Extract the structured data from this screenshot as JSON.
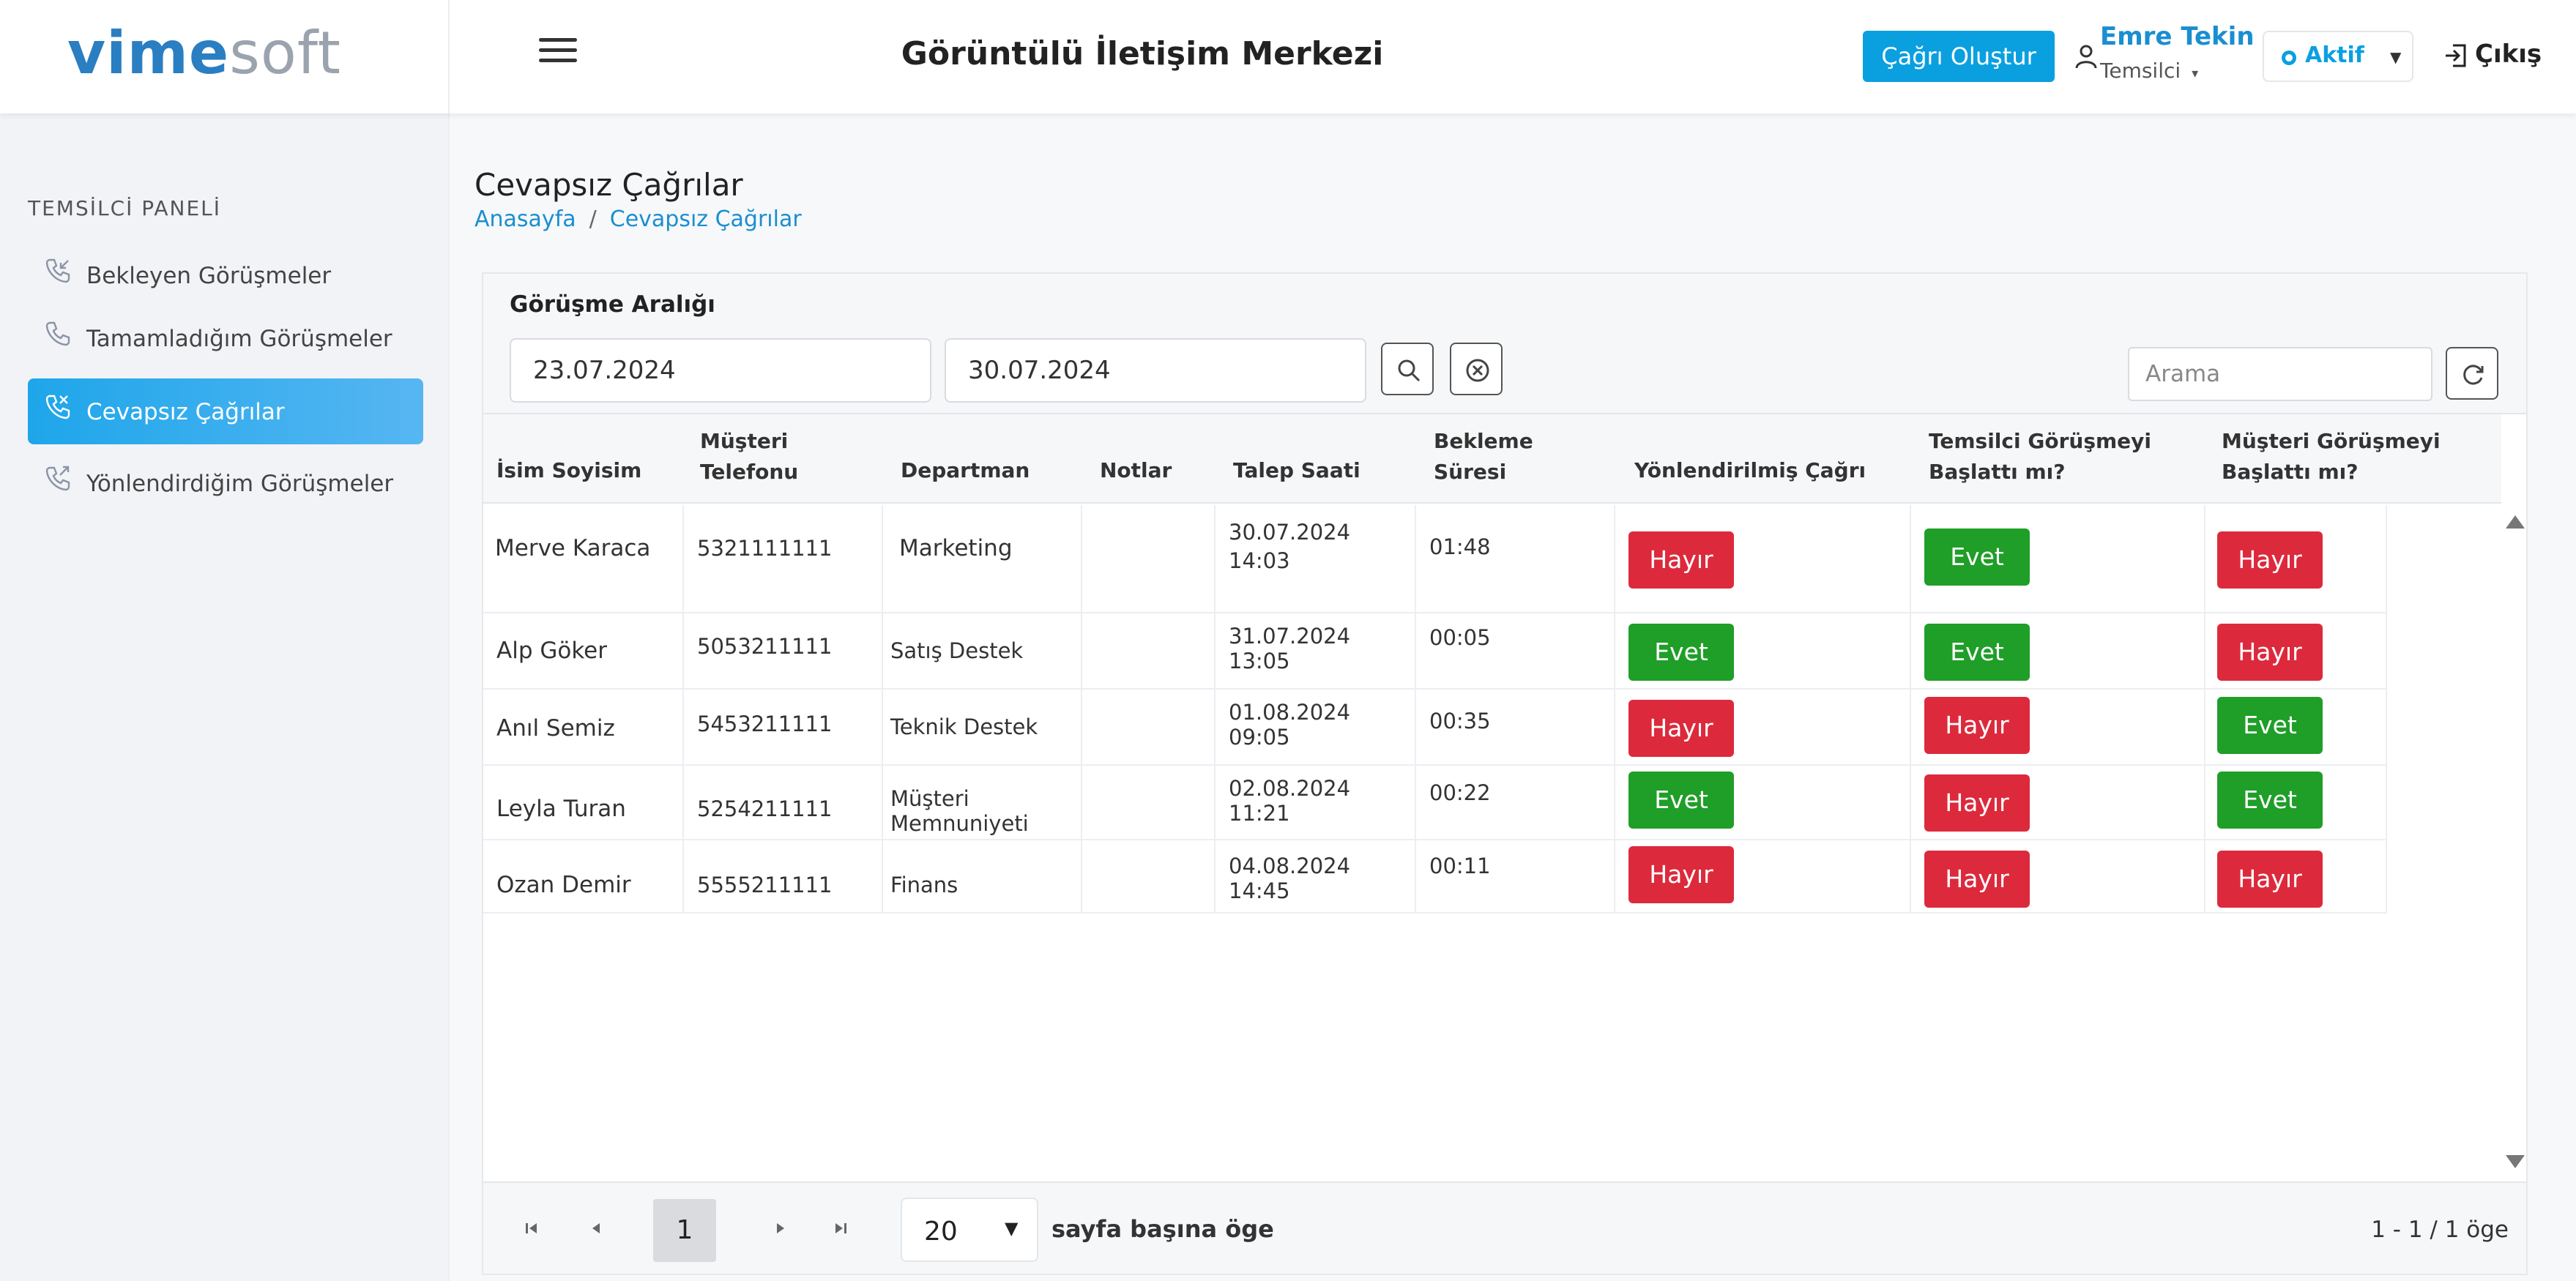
{
  "header": {
    "logo_part1": "vime",
    "logo_part2": "soft",
    "title": "Görüntülü İletişim Merkezi",
    "create_call_label": "Çağrı Oluştur",
    "user_name": "Emre Tekin",
    "user_role": "Temsilci",
    "status_label": "Aktif",
    "logout_label": "Çıkış"
  },
  "sidebar": {
    "section_title": "TEMSİLCİ PANELİ",
    "items": [
      {
        "label": "Bekleyen Görüşmeler",
        "icon": "phone-incoming-icon",
        "active": false
      },
      {
        "label": "Tamamladığım Görüşmeler",
        "icon": "phone-icon",
        "active": false
      },
      {
        "label": "Cevapsız Çağrılar",
        "icon": "phone-missed-icon",
        "active": true
      },
      {
        "label": "Yönlendirdiğim Görüşmeler",
        "icon": "phone-forwarded-icon",
        "active": false
      }
    ]
  },
  "page": {
    "title": "Cevapsız Çağrılar",
    "breadcrumb": [
      "Anasayfa",
      "Cevapsız Çağrılar"
    ]
  },
  "filter": {
    "label": "Görüşme Aralığı",
    "start_date": "23.07.2024",
    "end_date": "30.07.2024",
    "search_placeholder": "Arama"
  },
  "table": {
    "columns": [
      [
        "İsim Soyisim"
      ],
      [
        "Müşteri",
        "Telefonu"
      ],
      [
        "Departman"
      ],
      [
        "Notlar"
      ],
      [
        "Talep Saati"
      ],
      [
        "Bekleme",
        "Süresi"
      ],
      [
        "Yönlendirilmiş Çağrı"
      ],
      [
        "Temsilci Görüşmeyi",
        "Başlattı mı?"
      ],
      [
        "Müşteri Görüşmeyi",
        "Başlattı mı?"
      ]
    ],
    "rows": [
      {
        "name": "Merve Karaca",
        "phone": "5321111111",
        "department": [
          "Marketing"
        ],
        "notes": "",
        "request_time": [
          "30.07.2024",
          "14:03"
        ],
        "wait": "01:48",
        "forwarded": "Hayır",
        "agent_started": "Evet",
        "customer_started": "Hayır"
      },
      {
        "name": "Alp Göker",
        "phone": "5053211111",
        "department": [
          "Satış Destek"
        ],
        "notes": "",
        "request_time": [
          "31.07.2024",
          "13:05"
        ],
        "wait": "00:05",
        "forwarded": "Evet",
        "agent_started": "Evet",
        "customer_started": "Hayır"
      },
      {
        "name": "Anıl Semiz",
        "phone": "5453211111",
        "department": [
          "Teknik Destek"
        ],
        "notes": "",
        "request_time": [
          "01.08.2024",
          "09:05"
        ],
        "wait": "00:35",
        "forwarded": "Hayır",
        "agent_started": "Hayır",
        "customer_started": "Evet"
      },
      {
        "name": "Leyla Turan",
        "phone": "5254211111",
        "department": [
          "Müşteri",
          "Memnuniyeti"
        ],
        "notes": "",
        "request_time": [
          "02.08.2024",
          "11:21"
        ],
        "wait": "00:22",
        "forwarded": "Evet",
        "agent_started": "Hayır",
        "customer_started": "Evet"
      },
      {
        "name": "Ozan Demir",
        "phone": "5555211111",
        "department": [
          "Finans"
        ],
        "notes": "",
        "request_time": [
          "04.08.2024",
          "14:45"
        ],
        "wait": "00:11",
        "forwarded": "Hayır",
        "agent_started": "Hayır",
        "customer_started": "Hayır"
      }
    ]
  },
  "pagination": {
    "current_page": "1",
    "page_size": "20",
    "per_page_label": "sayfa başına öge",
    "range_text": "1 - 1 / 1 öge"
  },
  "colors": {
    "accent": "#0aa0e0",
    "yes": "#1f9e28",
    "no": "#dc2a3c"
  }
}
